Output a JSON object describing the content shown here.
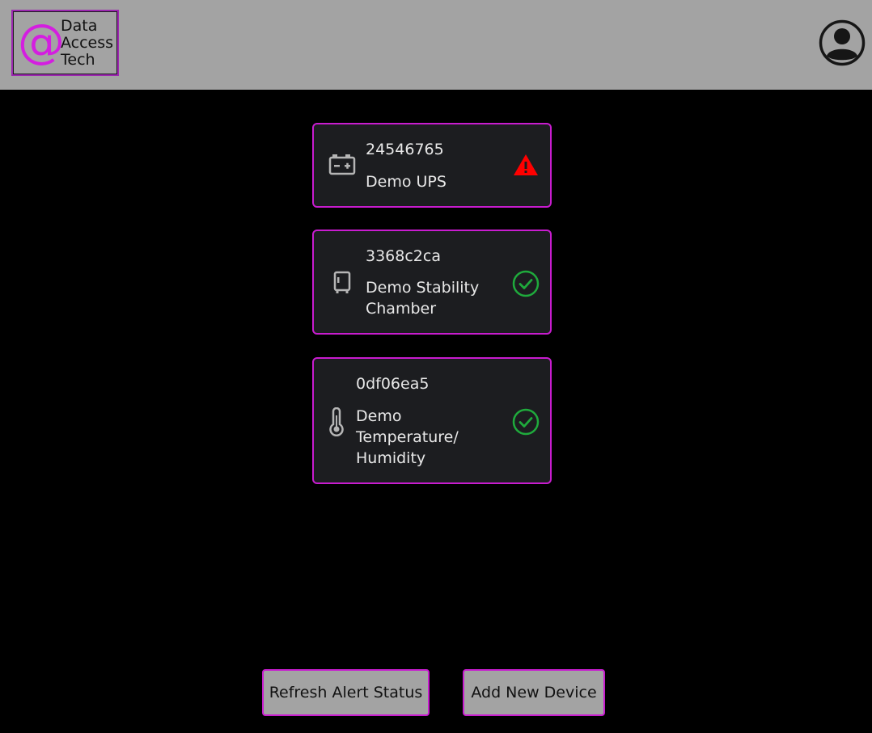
{
  "logo": {
    "symbol": "@",
    "line1": "Data",
    "line2": "Access",
    "line3": "Tech",
    "accent_color": "#d41ee0"
  },
  "header": {
    "user_icon": "user-account-icon"
  },
  "devices": [
    {
      "id": "24546765",
      "name": "Demo UPS",
      "icon": "battery-icon",
      "status": "alert",
      "status_icon": "warning-triangle-icon",
      "status_color": "#ff0000"
    },
    {
      "id": "3368c2ca",
      "name": "Demo Stability Chamber",
      "icon": "chamber-icon",
      "status": "ok",
      "status_icon": "check-circle-icon",
      "status_color": "#1faa3c"
    },
    {
      "id": "0df06ea5",
      "name": "Demo Temperature/ Humidity",
      "icon": "thermometer-icon",
      "status": "ok",
      "status_icon": "check-circle-icon",
      "status_color": "#1faa3c"
    }
  ],
  "actions": {
    "refresh_label": "Refresh Alert Status",
    "add_label": "Add New Device"
  }
}
